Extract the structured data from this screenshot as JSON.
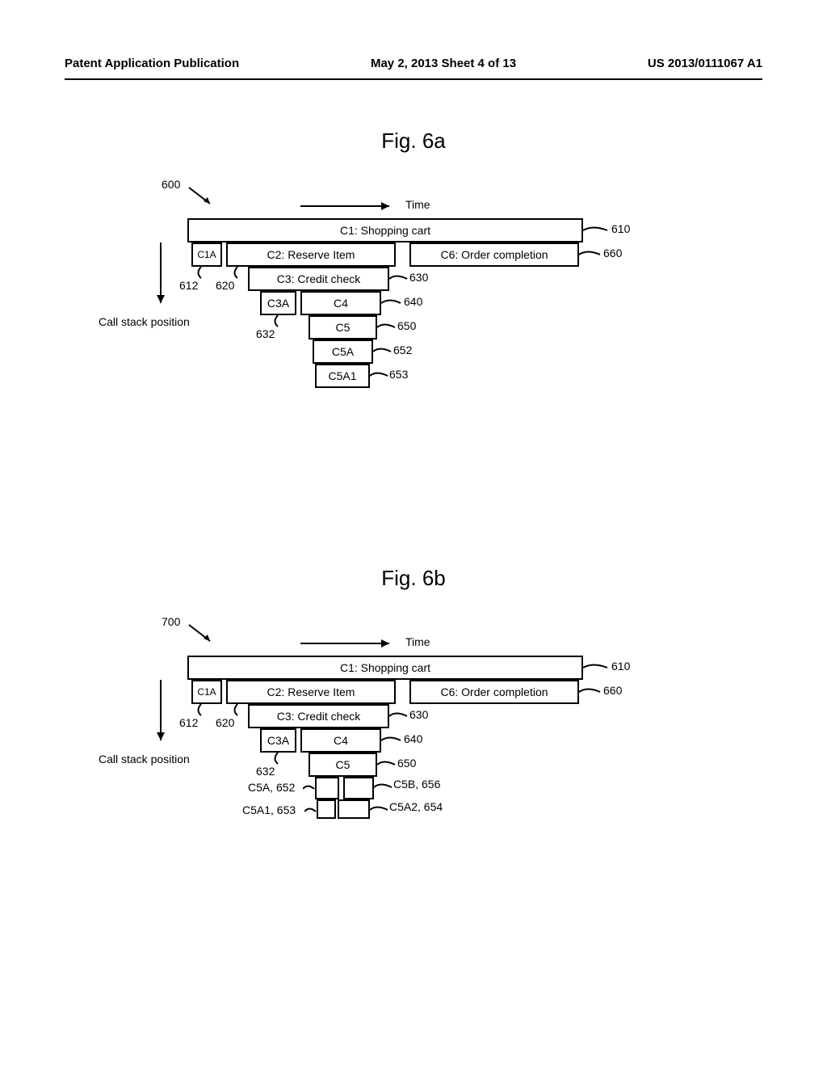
{
  "header": {
    "left": "Patent Application Publication",
    "mid": "May 2, 2013  Sheet 4 of 13",
    "right": "US 2013/0111067 A1"
  },
  "figA": {
    "title": "Fig. 6a",
    "ref_main": "600",
    "time": "Time",
    "stack": "Call stack position",
    "boxes": {
      "c1": "C1: Shopping cart",
      "c1a": "C1A",
      "c2": "C2: Reserve Item",
      "c6": "C6: Order completion",
      "c3": "C3: Credit check",
      "c3a": "C3A",
      "c4": "C4",
      "c5": "C5",
      "c5a": "C5A",
      "c5a1": "C5A1"
    },
    "refs": {
      "r610": "610",
      "r660": "660",
      "r612": "612",
      "r620": "620",
      "r630": "630",
      "r632": "632",
      "r640": "640",
      "r650": "650",
      "r652": "652",
      "r653": "653"
    }
  },
  "figB": {
    "title": "Fig. 6b",
    "ref_main": "700",
    "time": "Time",
    "stack": "Call stack position",
    "boxes": {
      "c1": "C1: Shopping cart",
      "c1a": "C1A",
      "c2": "C2: Reserve Item",
      "c6": "C6: Order completion",
      "c3": "C3: Credit check",
      "c3a": "C3A",
      "c4": "C4",
      "c5": "C5"
    },
    "refs": {
      "r610": "610",
      "r660": "660",
      "r612": "612",
      "r620": "620",
      "r630": "630",
      "r632": "632",
      "r640": "640",
      "r650": "650",
      "l_c5a": "C5A, 652",
      "l_c5a1": "C5A1, 653",
      "l_c5b": "C5B, 656",
      "l_c5a2": "C5A2, 654"
    }
  }
}
